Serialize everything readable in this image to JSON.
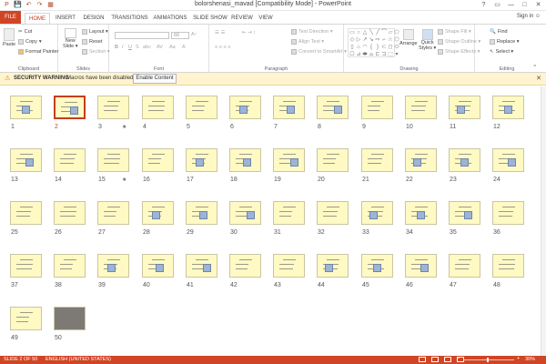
{
  "window": {
    "title": "bolorshenasi_mavad [Compatibility Mode] - PowerPoint",
    "controls": [
      "?",
      "▭",
      "—",
      "□",
      "✕"
    ]
  },
  "qat": [
    "P",
    "💾",
    "↶",
    "↷",
    "▦"
  ],
  "tabs": [
    "FILE",
    "HOME",
    "INSERT",
    "DESIGN",
    "TRANSITIONS",
    "ANIMATIONS",
    "SLIDE SHOW",
    "REVIEW",
    "VIEW"
  ],
  "active_tab": "HOME",
  "signin": "Sign in",
  "ribbon": {
    "clipboard": {
      "label": "Clipboard",
      "paste": "Paste",
      "cut": "Cut",
      "copy": "Copy",
      "format_painter": "Format Painter"
    },
    "slides": {
      "label": "Slides",
      "new_slide": "New",
      "new_slide2": "Slide ▾",
      "layout": "Layout ▾",
      "reset": "Reset",
      "section": "Section ▾"
    },
    "font": {
      "label": "Font",
      "size": "60"
    },
    "paragraph": {
      "label": "Paragraph",
      "text_direction": "Text Direction ▾",
      "align_text": "Align Text ▾",
      "convert_smartart": "Convert to SmartArt ▾"
    },
    "drawing": {
      "label": "Drawing",
      "arrange": "Arrange",
      "quick_styles": "Quick",
      "quick_styles2": "Styles ▾",
      "shape_fill": "Shape Fill ▾",
      "shape_outline": "Shape Outline ▾",
      "shape_effects": "Shape Effects ▾"
    },
    "editing": {
      "label": "Editing",
      "find": "Find",
      "replace": "Replace ▾",
      "select": "Select ▾"
    }
  },
  "security": {
    "title": "SECURITY WARNING",
    "message": "Macros have been disabled.",
    "button": "Enable Content",
    "close": "✕"
  },
  "slides": [
    {
      "n": "1"
    },
    {
      "n": "2"
    },
    {
      "n": "3"
    },
    {
      "n": "4"
    },
    {
      "n": "5"
    },
    {
      "n": "6"
    },
    {
      "n": "7"
    },
    {
      "n": "8"
    },
    {
      "n": "9"
    },
    {
      "n": "10"
    },
    {
      "n": "11"
    },
    {
      "n": "12"
    },
    {
      "n": "13"
    },
    {
      "n": "14"
    },
    {
      "n": "15"
    },
    {
      "n": "16"
    },
    {
      "n": "17"
    },
    {
      "n": "18"
    },
    {
      "n": "19"
    },
    {
      "n": "20"
    },
    {
      "n": "21"
    },
    {
      "n": "22"
    },
    {
      "n": "23"
    },
    {
      "n": "24"
    },
    {
      "n": "25"
    },
    {
      "n": "26"
    },
    {
      "n": "27"
    },
    {
      "n": "28"
    },
    {
      "n": "29"
    },
    {
      "n": "30"
    },
    {
      "n": "31"
    },
    {
      "n": "32"
    },
    {
      "n": "33"
    },
    {
      "n": "34"
    },
    {
      "n": "35"
    },
    {
      "n": "36"
    },
    {
      "n": "37"
    },
    {
      "n": "38"
    },
    {
      "n": "39"
    },
    {
      "n": "40"
    },
    {
      "n": "41"
    },
    {
      "n": "42"
    },
    {
      "n": "43"
    },
    {
      "n": "44"
    },
    {
      "n": "45"
    },
    {
      "n": "46"
    },
    {
      "n": "47"
    },
    {
      "n": "48"
    },
    {
      "n": "49"
    },
    {
      "n": "50"
    }
  ],
  "selected_slide": "2",
  "starred": [
    "3",
    "15"
  ],
  "status": {
    "slide_info": "SLIDE 2 OF 50",
    "language": "ENGLISH (UNITED STATES)",
    "zoom": "30%",
    "zoom_minus": "−",
    "zoom_plus": "+"
  },
  "colors": {
    "accent": "#d04525",
    "slide_bg": "#fff9c4",
    "security_bg": "#fff4ce"
  }
}
